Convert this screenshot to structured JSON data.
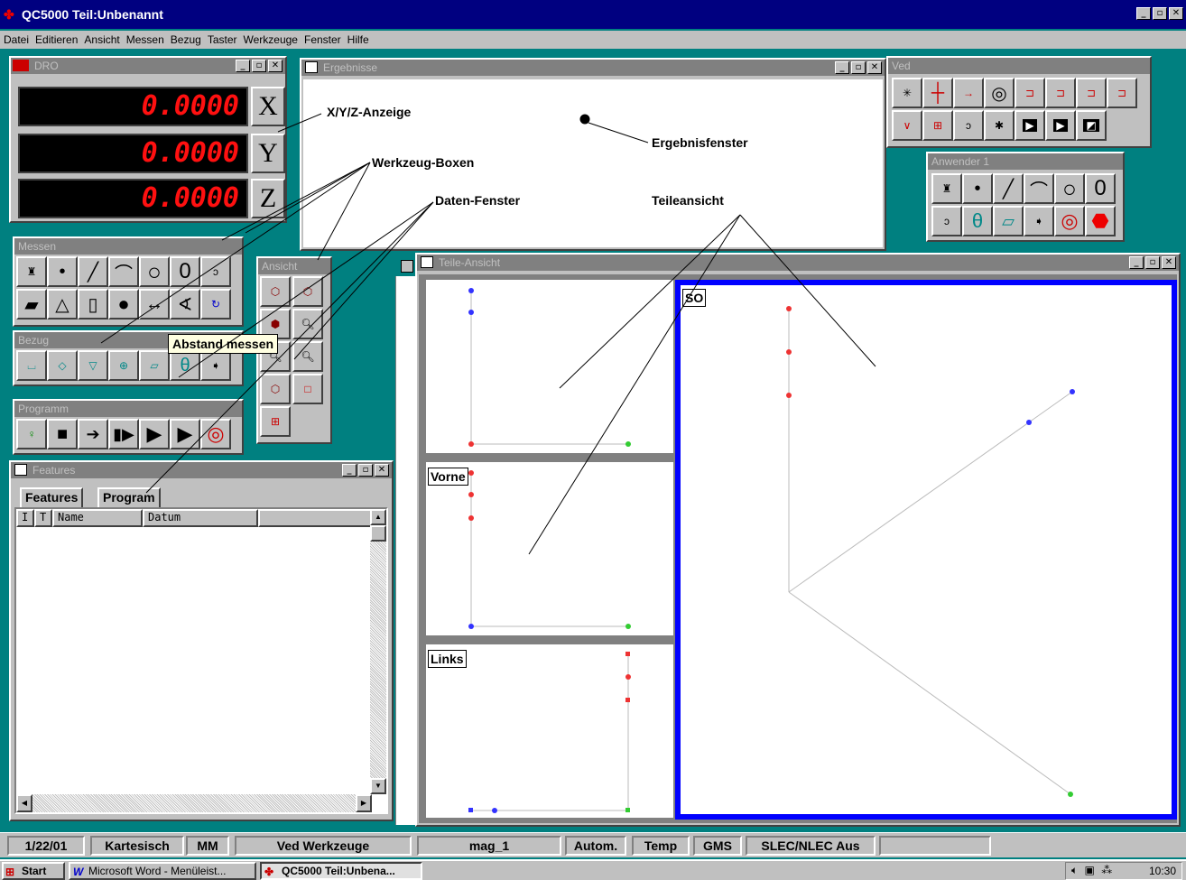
{
  "app": {
    "title": "QC5000 Teil:Unbenannt"
  },
  "menu": [
    "Datei",
    "Editieren",
    "Ansicht",
    "Messen",
    "Bezug",
    "Taster",
    "Werkzeuge",
    "Fenster",
    "Hilfe"
  ],
  "dro": {
    "title": "DRO",
    "x_value": "0.0000",
    "y_value": "0.0000",
    "z_value": "0.0000",
    "x_label": "X",
    "y_label": "Y",
    "z_label": "Z"
  },
  "ergebnisse": {
    "title": "Ergebnisse"
  },
  "ved": {
    "title": "Ved"
  },
  "anwender": {
    "title": "Anwender 1"
  },
  "messen": {
    "title": "Messen"
  },
  "bezug": {
    "title": "Bezug"
  },
  "programm": {
    "title": "Programm"
  },
  "ansicht": {
    "title": "Ansicht"
  },
  "tooltip": {
    "text": "Abstand messen"
  },
  "features": {
    "title": "Features",
    "tabs": [
      "Features",
      "Program"
    ],
    "columns": [
      "I",
      "T",
      "Name",
      "Datum"
    ]
  },
  "teile": {
    "title": "Teile-Ansicht",
    "views": {
      "so": "SO",
      "vorne": "Vorne",
      "links": "Links"
    }
  },
  "annotations": {
    "xyz": "X/Y/Z-Anzeige",
    "ergebnisfenster": "Ergebnisfenster",
    "werkzeug": "Werkzeug-Boxen",
    "daten": "Daten-Fenster",
    "teileansicht": "Teileansicht"
  },
  "status": {
    "date": "1/22/01",
    "coords": "Kartesisch",
    "units": "MM",
    "tools": "Ved Werkzeuge",
    "mag": "mag_1",
    "mode": "Autom.",
    "temp": "Temp",
    "gms": "GMS",
    "slec": "SLEC/NLEC Aus"
  },
  "taskbar": {
    "start": "Start",
    "word": "Microsoft Word - Menüleist...",
    "qc": "QC5000 Teil:Unbena...",
    "clock": "10:30"
  },
  "colors": {
    "titlebar": "#000080",
    "desktop": "#008080",
    "dro_digits": "#ff1010",
    "view_highlight": "#0000ff"
  }
}
